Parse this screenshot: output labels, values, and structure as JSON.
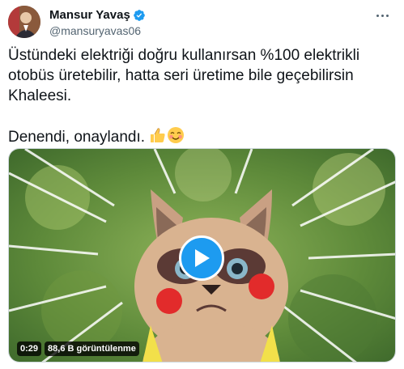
{
  "author": {
    "display_name": "Mansur Yavaş",
    "handle": "@mansuryavas06",
    "verified_icon": "verified-badge-icon",
    "avatar": "profile-photo"
  },
  "tweet": {
    "text": "Üstündeki elektriği doğru kullanırsan %100 elektrikli otobüs üretebilir, hatta seri üretime bile geçebilirsin Khaleesi.",
    "text2": "Denendi, onaylandı."
  },
  "media": {
    "type": "video",
    "duration": "0:29",
    "views": "88,6 B görüntülenme",
    "play_icon": "play-icon"
  },
  "colors": {
    "accent": "#1d9bf0",
    "secondary_text": "#536471"
  }
}
